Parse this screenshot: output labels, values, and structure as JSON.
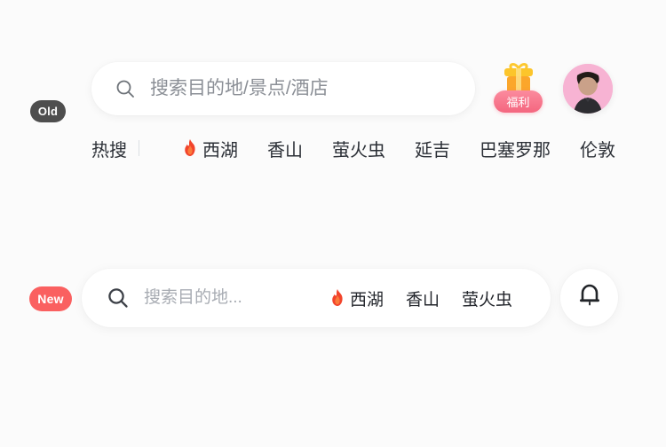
{
  "page": {
    "background_color": "#fbfbfb"
  },
  "old_variant": {
    "badge_label": "Old",
    "badge_color": "#4e4e4e",
    "search": {
      "icon": "search-icon",
      "placeholder": "搜索目的地/景点/酒店",
      "value": ""
    },
    "gift": {
      "icon": "gift-icon",
      "badge_label": "福利",
      "badge_color": "#f4667f"
    },
    "avatar": {
      "icon": "avatar",
      "background_color": "#f7b3d3"
    },
    "hot_label": "热搜",
    "tags": [
      {
        "label": "西湖",
        "hot": true
      },
      {
        "label": "香山",
        "hot": false
      },
      {
        "label": "萤火虫",
        "hot": false
      },
      {
        "label": "延吉",
        "hot": false
      },
      {
        "label": "巴塞罗那",
        "hot": false
      },
      {
        "label": "伦敦",
        "hot": false
      }
    ]
  },
  "new_variant": {
    "badge_label": "New",
    "badge_color": "#fa6060",
    "search": {
      "icon": "search-icon",
      "placeholder": "搜索目的地...",
      "value": ""
    },
    "tags": [
      {
        "label": "西湖",
        "hot": true
      },
      {
        "label": "香山",
        "hot": false
      },
      {
        "label": "萤火虫",
        "hot": false
      }
    ],
    "bell": {
      "icon": "bell-icon"
    }
  }
}
